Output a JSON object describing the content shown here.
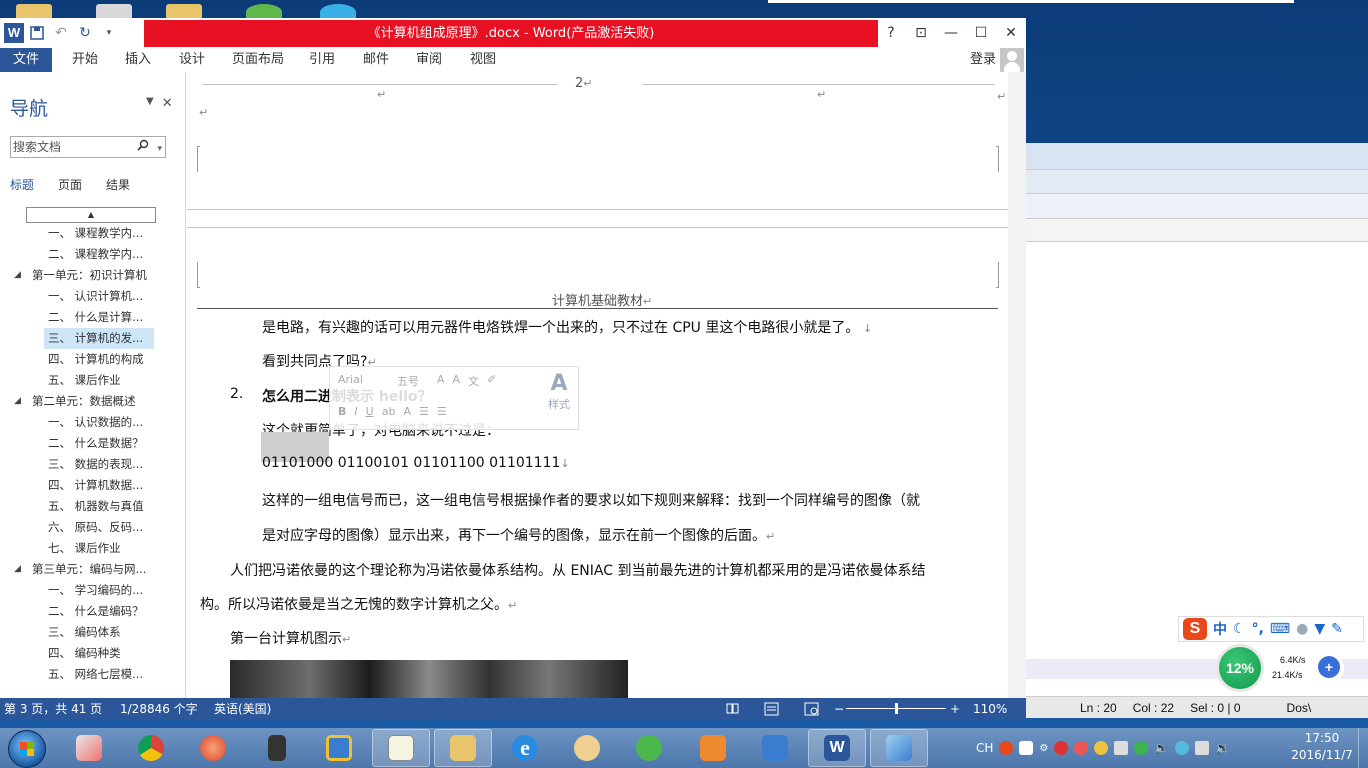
{
  "window": {
    "title": "《计算机组成原理》.docx -  Word(产品激活失败)",
    "help_label": "?",
    "login_label": "登录"
  },
  "menu": {
    "file": "文件",
    "tabs": [
      "开始",
      "插入",
      "设计",
      "页面布局",
      "引用",
      "邮件",
      "审阅",
      "视图"
    ]
  },
  "nav": {
    "title": "导航",
    "search_placeholder": "搜索文档",
    "tabs": [
      "标题",
      "页面",
      "结果"
    ],
    "items": [
      {
        "level": 2,
        "label": "一、 课程教学内..."
      },
      {
        "level": 2,
        "label": "二、 课程教学内..."
      },
      {
        "level": 1,
        "label": "第一单元：初识计算机"
      },
      {
        "level": 2,
        "label": "一、 认识计算机..."
      },
      {
        "level": 2,
        "label": "二、 什么是计算..."
      },
      {
        "level": 2,
        "label": "三、 计算机的发...",
        "selected": true
      },
      {
        "level": 2,
        "label": "四、 计算机的构成"
      },
      {
        "level": 2,
        "label": "五、 课后作业"
      },
      {
        "level": 1,
        "label": "第二单元：数据概述"
      },
      {
        "level": 2,
        "label": "一、 认识数据的..."
      },
      {
        "level": 2,
        "label": "二、 什么是数据？"
      },
      {
        "level": 2,
        "label": "三、 数据的表现..."
      },
      {
        "level": 2,
        "label": "四、 计算机数据..."
      },
      {
        "level": 2,
        "label": "五、 机器数与真值"
      },
      {
        "level": 2,
        "label": "六、 原码、反码..."
      },
      {
        "level": 2,
        "label": "七、 课后作业"
      },
      {
        "level": 1,
        "label": "第三单元：编码与网..."
      },
      {
        "level": 2,
        "label": "一、 学习编码的..."
      },
      {
        "level": 2,
        "label": "二、 什么是编码？"
      },
      {
        "level": 2,
        "label": "三、 编码体系"
      },
      {
        "level": 2,
        "label": "四、 编码种类"
      },
      {
        "level": 2,
        "label": "五、 网络七层模..."
      }
    ]
  },
  "doc": {
    "page_number": "2",
    "header_text": "计算机基础教材",
    "p1": "是电路，有兴趣的话可以用元器件电烙铁焊一个出来的，只不过在 CPU 里这个电路很小就是了。",
    "p2": "看到共同点了吗?",
    "list_num": "2.",
    "list_heading": "怎么用二进制表示 hello？",
    "p3": "这个就更简单了，对电脑来说不过是：",
    "binary_first": "01101000",
    "binary_rest": " 01100101 01101100 01101111",
    "p4": "这样的一组电信号而已，这一组电信号根据操作者的要求以如下规则来解释：找到一个同样编号的图像（就",
    "p5": "是对应字母的图像）显示出来，再下一个编号的图像，显示在前一个图像的后面。",
    "p6": "人们把冯诺依曼的这个理论称为冯诺依曼体系结构。从 ENIAC 到当前最先进的计算机都采用的是冯诺依曼体系结",
    "p7": "构。所以冯诺依曼是当之无愧的数字计算机之父。",
    "p8": "第一台计算机图示",
    "mini_toolbar": {
      "font": "Arial",
      "size": "五号",
      "styles": "样式"
    }
  },
  "status": {
    "page": "第 3 页，共 41 页",
    "words": "1/28846 个字",
    "lang": "英语(美国)",
    "zoom": "110%",
    "zoom_percent": 110
  },
  "bg_window": {
    "ln": "Ln : 20",
    "col": "Col : 22",
    "sel": "Sel : 0 | 0",
    "dos": "Dos\\"
  },
  "ime": {
    "label": "中"
  },
  "net": {
    "cpu": "12%",
    "up": "6.4K/s",
    "down": "21.4K/s"
  },
  "tray": {
    "lang": "CH"
  },
  "clock": {
    "time": "17:50",
    "date": "2016/11/7"
  },
  "colors": {
    "word_blue": "#2b579a",
    "title_red": "#e81123",
    "nav_selected": "#cde6f7"
  }
}
